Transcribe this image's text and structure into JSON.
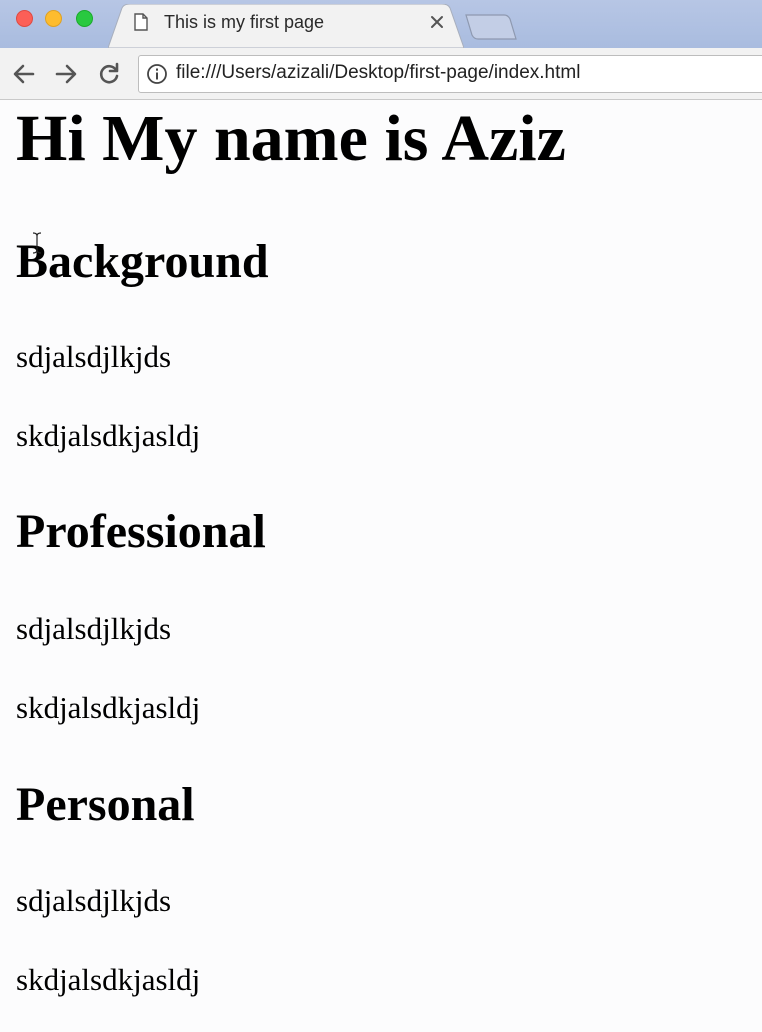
{
  "browser": {
    "tab": {
      "title": "This is my first page"
    },
    "address_bar": {
      "url": "file:///Users/azizali/Desktop/first-page/index.html"
    },
    "icons": [
      "document-icon",
      "close-icon",
      "back-arrow-icon",
      "forward-arrow-icon",
      "reload-icon",
      "info-icon"
    ]
  },
  "page": {
    "heading": "Hi My name is Aziz",
    "sections": [
      {
        "title": "Background",
        "paragraphs": [
          "sdjalsdjlkjds",
          "skdjalsdkjasldj"
        ]
      },
      {
        "title": "Professional",
        "paragraphs": [
          "sdjalsdjlkjds",
          "skdjalsdkjasldj"
        ]
      },
      {
        "title": "Personal",
        "paragraphs": [
          "sdjalsdjlkjds",
          "skdjalsdkjasldj"
        ]
      }
    ]
  }
}
